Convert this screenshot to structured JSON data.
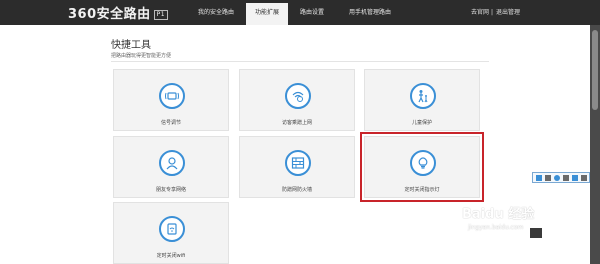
{
  "header": {
    "logo_text": "360安全路由",
    "model_badge": "P1",
    "tabs": [
      {
        "label": "我的安全路由"
      },
      {
        "label": "功能扩展"
      },
      {
        "label": "路由设置"
      },
      {
        "label": "用手机管理路由"
      }
    ],
    "links": [
      {
        "label": "去官网"
      },
      {
        "label": "|"
      },
      {
        "label": "退出管理"
      }
    ]
  },
  "section": {
    "title": "快捷工具",
    "subtitle": "把路由器玩得更智能更方便"
  },
  "tools": [
    {
      "label": "信号调节",
      "icon": "signal-icon"
    },
    {
      "label": "访客乘蹭上网",
      "icon": "visitor-wifi-icon"
    },
    {
      "label": "儿童保护",
      "icon": "child-protect-icon"
    },
    {
      "label": "朋友专享网络",
      "icon": "friend-network-icon"
    },
    {
      "label": "防蹭网防火墙",
      "icon": "firewall-icon"
    },
    {
      "label": "定时关闭指示灯",
      "icon": "light-bulb-icon"
    },
    {
      "label": "定时关闭wifi",
      "icon": "wifi-timer-icon"
    }
  ],
  "watermark": {
    "brand": "Baidu 经验",
    "url": "jingyan.baidu.com"
  },
  "colors": {
    "accent": "#3a8fd6",
    "highlight": "#c8242a",
    "topbar": "#2c2c2c"
  }
}
